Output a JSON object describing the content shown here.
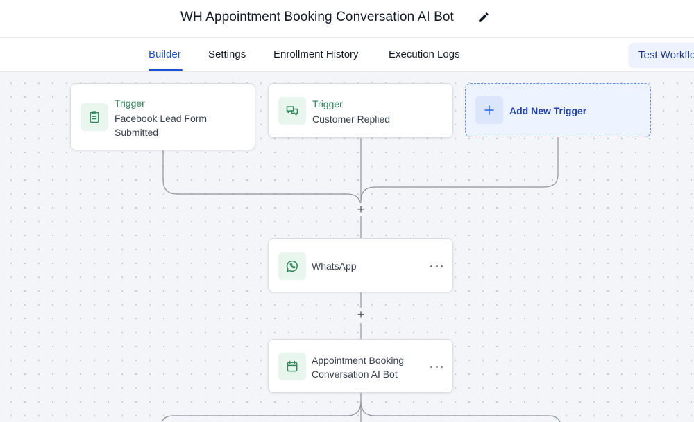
{
  "header": {
    "title": "WH Appointment Booking Conversation AI Bot",
    "edit_icon": "pencil-icon"
  },
  "tabs": [
    {
      "label": "Builder",
      "active": true
    },
    {
      "label": "Settings",
      "active": false
    },
    {
      "label": "Enrollment History",
      "active": false
    },
    {
      "label": "Execution Logs",
      "active": false
    }
  ],
  "test_button": {
    "label": "Test Workflow"
  },
  "triggers": [
    {
      "kicker": "Trigger",
      "text": "Facebook Lead Form Submitted",
      "icon": "clipboard-icon"
    },
    {
      "kicker": "Trigger",
      "text": "Customer Replied",
      "icon": "chat-bubbles-icon"
    }
  ],
  "add_trigger": {
    "label": "Add New Trigger",
    "icon": "plus-icon"
  },
  "actions": [
    {
      "text": "WhatsApp",
      "icon": "whatsapp-icon"
    },
    {
      "text": "Appointment Booking Conversation AI Bot",
      "icon": "calendar-icon"
    }
  ],
  "add_step_symbol": "+",
  "colors": {
    "accent": "#1d4ed8",
    "trigger_green": "#2f855a",
    "icon_bg": "#e8f6ee",
    "add_trigger_bg": "#eef4ff",
    "canvas_bg": "#f4f5f8"
  }
}
